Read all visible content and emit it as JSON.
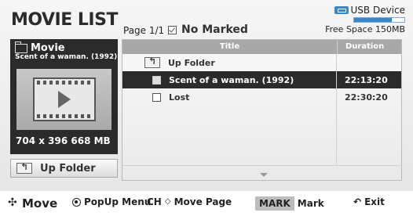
{
  "header": {
    "title": "MOVIE LIST",
    "page_info": "Page 1/1",
    "marked_label": "No Marked"
  },
  "usb": {
    "device_label": "USB Device",
    "free_space": "Free Space 150MB",
    "used_fraction": 0.75,
    "icon": "usb-icon",
    "accent_color": "#3a87c8"
  },
  "preview": {
    "category": "Movie",
    "filename": "Scent of a waman. (1992)",
    "resolution_size": "704 x 396  668 MB",
    "icon": "movie-folder-icon"
  },
  "up_folder_button": {
    "label": "Up Folder",
    "icon": "up-folder-icon"
  },
  "list": {
    "columns": {
      "title": "Title",
      "duration": "Duration"
    },
    "rows": [
      {
        "title": "Up Folder",
        "duration": "",
        "type": "up"
      },
      {
        "title": "Scent of a waman. (1992)",
        "duration": "22:13:20",
        "type": "file",
        "selected": true
      },
      {
        "title": "Lost",
        "duration": "22:30:20",
        "type": "file",
        "selected": false
      }
    ]
  },
  "footer": {
    "move": "Move",
    "popup_menu": "PopUp Menu",
    "ch": "CH",
    "move_page": "Move Page",
    "mark_key": "MARK",
    "mark": "Mark",
    "exit": "Exit"
  }
}
